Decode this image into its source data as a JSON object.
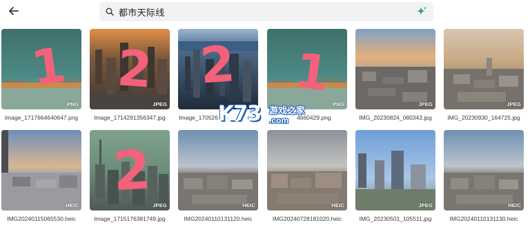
{
  "header": {
    "search_query": "都市天际线",
    "icons": {
      "back": "back-arrow-icon",
      "search": "search-icon",
      "ai": "ai-sparkle-icon"
    },
    "accent_color": "#34a853"
  },
  "images": [
    {
      "name": "Image_1717664640647.png",
      "type": "PNG",
      "annotation": "1"
    },
    {
      "name": "Image_1714291356347.jpg",
      "type": "JPEG",
      "annotation": "2"
    },
    {
      "name": "Image_170526",
      "type": "",
      "annotation": "2"
    },
    {
      "name": "4660429.png",
      "type": "PNG",
      "annotation": "1"
    },
    {
      "name": "IMG_20230824_080343.jpg",
      "type": "JPEG",
      "annotation": ""
    },
    {
      "name": "IMG_20230930_164725.jpg",
      "type": "JPEG",
      "annotation": ""
    },
    {
      "name": "IMG20240115065530.heic",
      "type": "HEIC",
      "annotation": ""
    },
    {
      "name": "Image_1715176381749.jpg",
      "type": "JPEG",
      "annotation": "2"
    },
    {
      "name": "IMG20240110131120.heic",
      "type": "HEIC",
      "annotation": ""
    },
    {
      "name": "IMG20240728181020.heic",
      "type": "HEIC",
      "annotation": ""
    },
    {
      "name": "IMG_20230501_105511.jpg",
      "type": "JPEG",
      "annotation": ""
    },
    {
      "name": "IMG20240110131130.heic",
      "type": "HEIC",
      "annotation": ""
    }
  ],
  "annotation_color": "#f4617a",
  "watermark": {
    "brand": "K73",
    "name": "游戏之家",
    "domain": ".com"
  }
}
